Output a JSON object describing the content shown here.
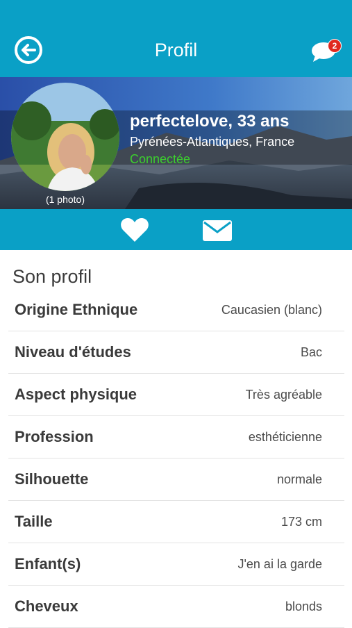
{
  "header": {
    "title": "Profil",
    "back_icon": "back-arrow-circle-icon",
    "messages_icon": "chat-bubble-icon",
    "unread_count": "2",
    "color": "#0aa0c6"
  },
  "profile": {
    "username_age": "perfectelove, 33 ans",
    "location": "Pyrénées-Atlantiques, France",
    "status": "Connectée",
    "status_color": "#3ccf2e",
    "photo_count": "(1 photo)"
  },
  "actions": {
    "like_icon": "heart-icon",
    "message_icon": "envelope-icon"
  },
  "section": {
    "title": "Son profil",
    "rows": [
      {
        "label": "Origine Ethnique",
        "value": "Caucasien (blanc)"
      },
      {
        "label": "Niveau d'études",
        "value": "Bac"
      },
      {
        "label": "Aspect physique",
        "value": "Très agréable"
      },
      {
        "label": "Profession",
        "value": "esthéticienne"
      },
      {
        "label": "Silhouette",
        "value": "normale"
      },
      {
        "label": "Taille",
        "value": "173 cm"
      },
      {
        "label": "Enfant(s)",
        "value": "J'en ai la garde"
      },
      {
        "label": "Cheveux",
        "value": "blonds"
      }
    ]
  }
}
